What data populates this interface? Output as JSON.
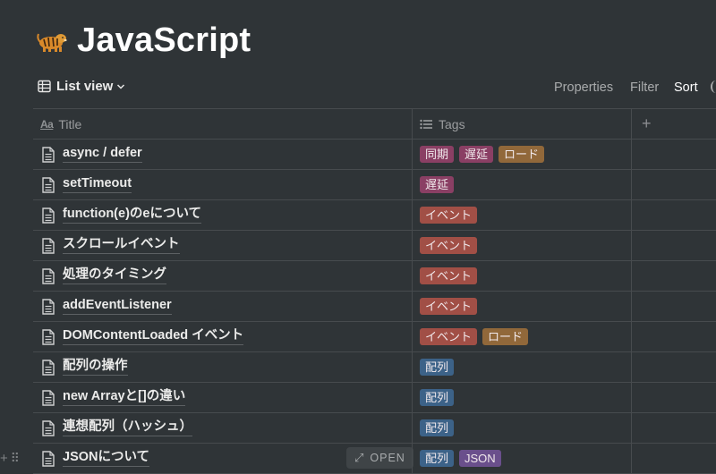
{
  "page": {
    "title": "JavaScript",
    "icon": "tiger-icon"
  },
  "toolbar": {
    "view_label": "List view",
    "properties_label": "Properties",
    "filter_label": "Filter",
    "sort_label": "Sort"
  },
  "table": {
    "columns": [
      {
        "label": "Title",
        "icon": "text-aa-icon"
      },
      {
        "label": "Tags",
        "icon": "list-icon"
      },
      {
        "label": "+",
        "icon": "plus-icon"
      }
    ],
    "rows": [
      {
        "title": "async / defer",
        "tags": [
          "同期",
          "遅延",
          "ロード"
        ]
      },
      {
        "title": "setTimeout",
        "tags": [
          "遅延"
        ]
      },
      {
        "title": "function(e)のeについて",
        "tags": [
          "イベント"
        ]
      },
      {
        "title": "スクロールイベント",
        "tags": [
          "イベント"
        ]
      },
      {
        "title": "処理のタイミング",
        "tags": [
          "イベント"
        ]
      },
      {
        "title": "addEventListener",
        "tags": [
          "イベント"
        ]
      },
      {
        "title": "DOMContentLoaded イベント",
        "tags": [
          "イベント",
          "ロード"
        ]
      },
      {
        "title": "配列の操作",
        "tags": [
          "配列"
        ]
      },
      {
        "title": "new Arrayと[]の違い",
        "tags": [
          "配列"
        ]
      },
      {
        "title": "連想配列（ハッシュ）",
        "tags": [
          "配列"
        ]
      },
      {
        "title": "JSONについて",
        "tags": [
          "配列",
          "JSON"
        ],
        "hovered": true
      }
    ],
    "open_label": "OPEN"
  },
  "tag_colors": {
    "同期": "#8a3f64",
    "遅延": "#8a3f64",
    "ロード": "#91683a",
    "イベント": "#a14f46",
    "配列": "#3c6288",
    "JSON": "#6a4f8c"
  }
}
